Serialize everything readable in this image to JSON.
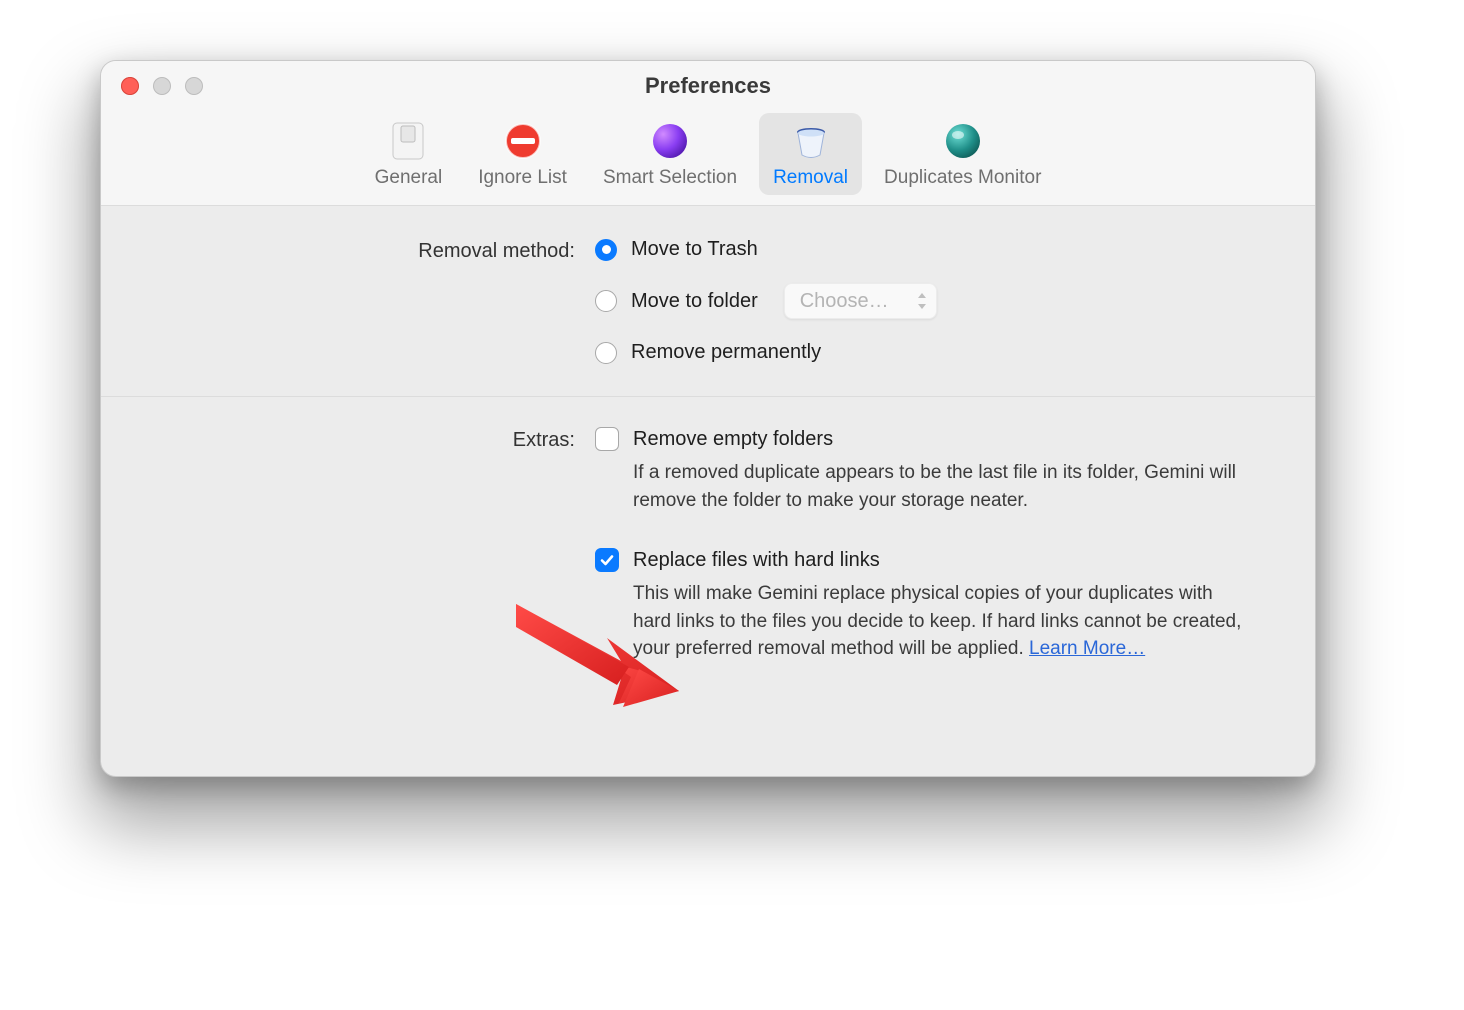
{
  "window": {
    "title": "Preferences"
  },
  "tabs": [
    {
      "label": "General"
    },
    {
      "label": "Ignore List"
    },
    {
      "label": "Smart Selection"
    },
    {
      "label": "Removal"
    },
    {
      "label": "Duplicates Monitor"
    }
  ],
  "removal": {
    "section_label": "Removal method:",
    "options": {
      "trash": "Move to Trash",
      "folder": "Move to folder",
      "perm": "Remove permanently"
    },
    "choose_placeholder": "Choose…"
  },
  "extras": {
    "section_label": "Extras:",
    "empty_folders": {
      "label": "Remove empty folders",
      "help": "If a removed duplicate appears to be the last file in its folder, Gemini will remove the folder to make your storage neater."
    },
    "hardlinks": {
      "label": "Replace files with hard links",
      "help": "This will make Gemini replace physical copies of your duplicates with hard links to the files you decide to keep. If hard links cannot be created, your preferred removal method will be applied. ",
      "learn_more": "Learn More…"
    }
  }
}
